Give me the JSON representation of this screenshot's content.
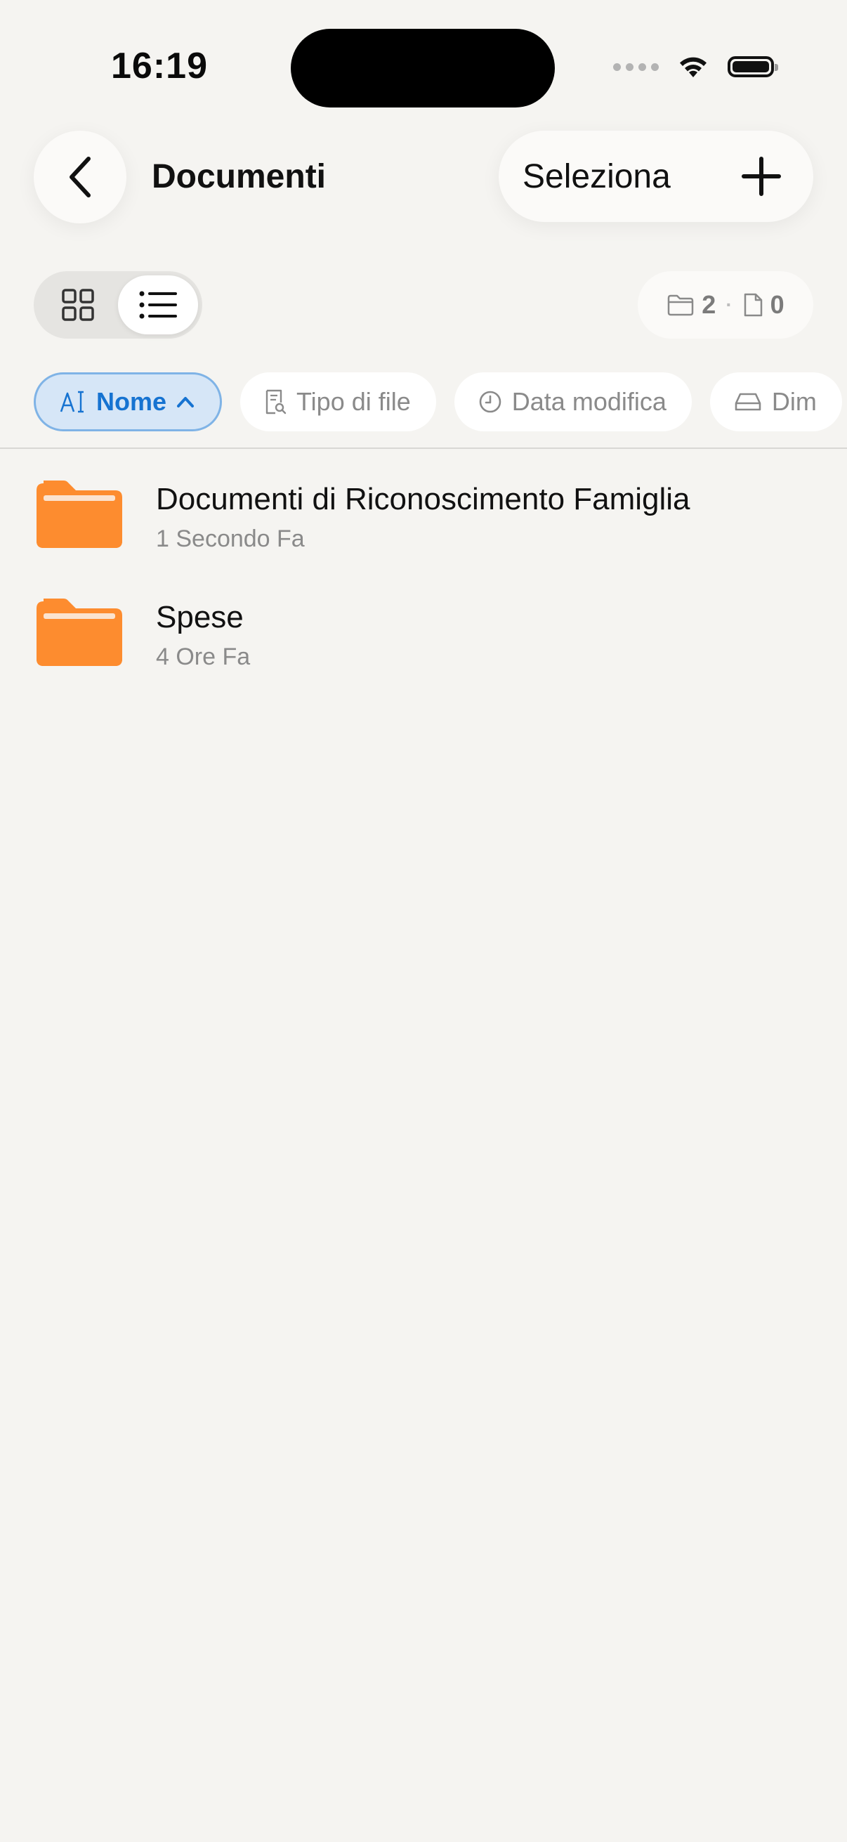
{
  "status_bar": {
    "time": "16:19"
  },
  "nav": {
    "title": "Documenti",
    "select_label": "Seleziona"
  },
  "counts": {
    "folders": "2",
    "files": "0"
  },
  "sort_chips": [
    {
      "label": "Nome",
      "active": true
    },
    {
      "label": "Tipo di file"
    },
    {
      "label": "Data modifica"
    },
    {
      "label": "Dim"
    }
  ],
  "colors": {
    "accent": "#1673d1",
    "folder": "#fd8c2f",
    "background": "#f5f4f1"
  },
  "items": [
    {
      "name": "Documenti di Riconoscimento Famiglia",
      "modified": "1 Secondo Fa"
    },
    {
      "name": "Spese",
      "modified": "4 Ore Fa"
    }
  ]
}
